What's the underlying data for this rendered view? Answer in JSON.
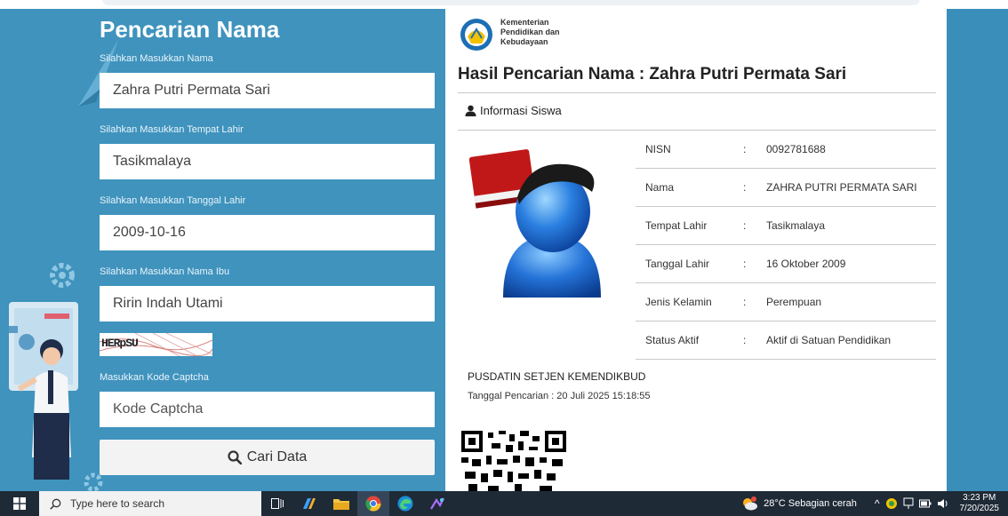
{
  "form": {
    "title": "Pencarian Nama",
    "name_label": "Silahkan Masukkan Nama",
    "name_value": "Zahra Putri Permata Sari",
    "birthplace_label": "Silahkan Masukkan Tempat Lahir",
    "birthplace_value": "Tasikmalaya",
    "birthdate_label": "Silahkan Masukkan Tanggal Lahir",
    "birthdate_value": "2009-10-16",
    "mother_label": "Silahkan Masukkan Nama Ibu",
    "mother_value": "Ririn Indah Utami",
    "captcha_text": "HERpSU",
    "captcha_label": "Masukkan Kode Captcha",
    "captcha_placeholder": "Kode Captcha",
    "search_button": "Cari Data",
    "search_icon": "magnifier-icon"
  },
  "card": {
    "ministry_line1": "Kementerian",
    "ministry_line2": "Pendidikan dan",
    "ministry_line3": "Kebudayaan",
    "result_title": "Hasil Pencarian Nama : Zahra Putri Permata Sari",
    "section_title": "Informasi Siswa",
    "section_icon": "user-icon",
    "separator": ":",
    "rows": [
      {
        "label": "NISN",
        "value": "0092781688"
      },
      {
        "label": "Nama",
        "value": "ZAHRA PUTRI PERMATA SARI"
      },
      {
        "label": "Tempat Lahir",
        "value": "Tasikmalaya"
      },
      {
        "label": "Tanggal Lahir",
        "value": "16 Oktober 2009"
      },
      {
        "label": "Jenis Kelamin",
        "value": "Perempuan"
      },
      {
        "label": "Status Aktif",
        "value": "Aktif di Satuan Pendidikan"
      }
    ],
    "footer_org": "PUSDATIN SETJEN KEMENDIKBUD",
    "footer_date": "Tanggal Pencarian : 20 Juli 2025 15:18:55"
  },
  "taskbar": {
    "search_placeholder": "Type here to search",
    "weather": "28°C  Sebagian cerah",
    "time": "3:23 PM",
    "date": "7/20/2025"
  },
  "colors": {
    "background": "#3f93bd",
    "card": "#ffffff",
    "taskbar": "#1f2a37"
  }
}
